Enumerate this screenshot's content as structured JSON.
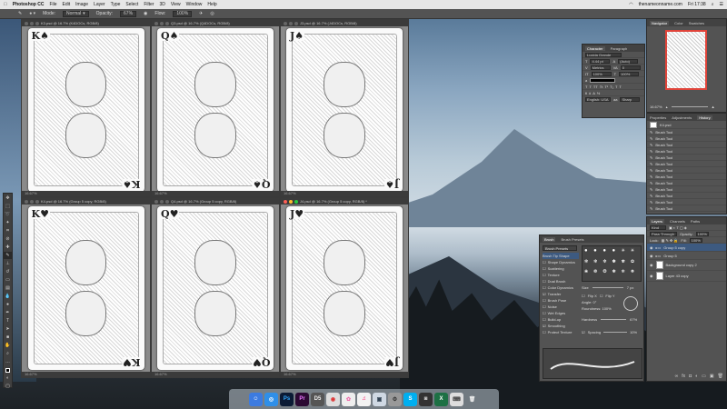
{
  "menubar": {
    "apple": "",
    "app": "Photoshop CC",
    "items": [
      "File",
      "Edit",
      "Image",
      "Layer",
      "Type",
      "Select",
      "Filter",
      "3D",
      "View",
      "Window",
      "Help"
    ],
    "right": [
      "thenameonname.com",
      "Fri 17:38"
    ]
  },
  "optbar": {
    "mode_label": "Mode:",
    "mode": "Normal",
    "opacity_label": "Opacity:",
    "opacity": "67%",
    "flow_label": "Flow:",
    "flow": "100%"
  },
  "docs": [
    {
      "title": "K3.psd @ 16.7% (K4DOCs, RGB/8)",
      "rank": "K",
      "suit": "♠",
      "status": "16.67%"
    },
    {
      "title": "Q3.psd @ 16.7% (Q4DOCs, RGB/8)",
      "rank": "Q",
      "suit": "♠",
      "status": "16.67%"
    },
    {
      "title": "J3.psd @ 16.7% (J4DOCs, RGB/8)",
      "rank": "J",
      "suit": "♠",
      "status": "16.67%"
    },
    {
      "title": "K4.psd @ 16.7% (Group 5 copy, RGB/8)",
      "rank": "K",
      "suit": "♥",
      "status": "16.67%"
    },
    {
      "title": "Q4.psd @ 16.7% (Group 5 copy, RGB/8)",
      "rank": "Q",
      "suit": "♥",
      "status": "16.67%"
    },
    {
      "title": "J4.psd @ 16.7% (Group 5 copy, RGB/8) *",
      "rank": "J",
      "suit": "♥",
      "status": "16.67%"
    }
  ],
  "navigator": {
    "tabs": [
      "Navigator",
      "Color",
      "Swatches"
    ],
    "zoom": "16.67%"
  },
  "character": {
    "tabs": [
      "Character",
      "Paragraph"
    ],
    "font": "Lucida Grande",
    "size": "4.44 pt",
    "leading": "(Auto)",
    "kerning": "Metrics",
    "tracking": "0",
    "scale": "100%",
    "lang": "English: USA",
    "aa": "Sharp"
  },
  "history": {
    "tabs": [
      "Properties",
      "Adjustments",
      "History"
    ],
    "snapshot": "K4.psd",
    "items": [
      "Brush Tool",
      "Brush Tool",
      "Brush Tool",
      "Brush Tool",
      "Brush Tool",
      "Brush Tool",
      "Brush Tool",
      "Brush Tool",
      "Brush Tool",
      "Brush Tool",
      "Brush Tool",
      "Brush Tool",
      "Brush Tool",
      "Brush Tool"
    ]
  },
  "layers": {
    "tabs": [
      "Layers",
      "Channels",
      "Paths"
    ],
    "kind": "Kind",
    "blend": "Pass Through",
    "opacity_label": "Opacity:",
    "opacity": "100%",
    "fill_label": "Fill:",
    "fill": "100%",
    "lock_label": "Lock:",
    "items": [
      "Group 5 copy",
      "Group 5",
      "Background copy 2",
      "Layer 43 copy"
    ]
  },
  "brush": {
    "tabs": [
      "Brush",
      "Brush Presets"
    ],
    "presets_btn": "Brush Presets",
    "options": [
      "Brush Tip Shape",
      "Shape Dynamics",
      "Scattering",
      "Texture",
      "Dual Brush",
      "Color Dynamics",
      "Transfer",
      "Brush Pose",
      "Noise",
      "Wet Edges",
      "Build-up",
      "Smoothing",
      "Protect Texture"
    ],
    "size_label": "Size",
    "size": "7 px",
    "flip_x": "Flip X",
    "flip_y": "Flip Y",
    "angle_label": "Angle:",
    "angle": "0°",
    "roundness_label": "Roundness:",
    "roundness": "100%",
    "hardness_label": "Hardness",
    "hardness": "67%",
    "spacing_label": "Spacing",
    "spacing": "10%"
  },
  "dock": [
    "Finder",
    "Safari",
    "Ps",
    "Pr",
    "D5",
    "Chrome",
    "Photos",
    "iTunes",
    "Preview",
    "Settings",
    "Skype",
    "Camera",
    "Excel",
    "Keyboard",
    "Trash"
  ]
}
